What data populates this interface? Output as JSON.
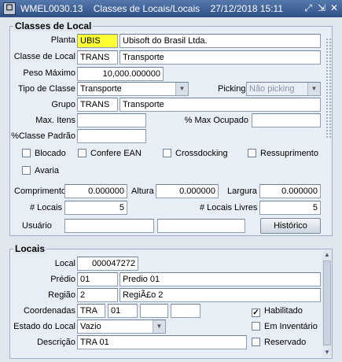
{
  "window": {
    "app_icon": "oracle-forms-icon",
    "title": "WMEL0030.13",
    "subtitle": "Classes de Locais/Locais",
    "datetime": "27/12/2018 15:11"
  },
  "classe": {
    "section_title": "Classes de Local",
    "planta_label": "Planta",
    "planta_code": "UBIS",
    "planta_name": "Ubisoft do Brasil Ltda.",
    "classe_label": "Classe de Local",
    "classe_code": "TRANS",
    "classe_name": "Transporte",
    "peso_label": "Peso Máximo",
    "peso_value": "10,000.000000",
    "tipo_label": "Tipo de Classe",
    "tipo_value": "Transporte",
    "picking_label": "Picking",
    "picking_value": "Não picking",
    "grupo_label": "Grupo",
    "grupo_code": "TRANS",
    "grupo_name": "Transporte",
    "max_itens_label": "Max. Itens",
    "max_itens_value": "",
    "max_ocupado_label": "% Max Ocupado",
    "max_ocupado_value": "",
    "classe_padrao_label": "%Classe Padrão",
    "classe_padrao_value": "",
    "checkboxes": {
      "blocado": {
        "label": "Blocado",
        "checked": false
      },
      "confere_ean": {
        "label": "Confere EAN",
        "checked": false
      },
      "crossdocking": {
        "label": "Crossdocking",
        "checked": false
      },
      "ressuprimento": {
        "label": "Ressuprimento",
        "checked": false
      },
      "avaria": {
        "label": "Avaria",
        "checked": false
      }
    },
    "comprimento_label": "Comprimento",
    "comprimento_value": "0.000000",
    "altura_label": "Altura",
    "altura_value": "0.000000",
    "largura_label": "Largura",
    "largura_value": "0.000000",
    "locais_label": "# Locais",
    "locais_value": "5",
    "locais_livres_label": "# Locais Livres",
    "locais_livres_value": "5",
    "usuario_label": "Usuário",
    "usuario_value": "",
    "usuario_extra": "",
    "historico_button": "Histórico"
  },
  "locais": {
    "section_title": "Locais",
    "local_label": "Local",
    "local_value": "000047272",
    "predio_label": "Prédio",
    "predio_code": "01",
    "predio_name": "Predio 01",
    "regiao_label": "Região",
    "regiao_code": "2",
    "regiao_name": "RegiÃ£o 2",
    "coord_label": "Coordenadas",
    "coord_values": [
      "TRA",
      "01",
      "",
      ""
    ],
    "habilitado": {
      "label": "Habilitado",
      "checked": true
    },
    "estado_label": "Estado do Local",
    "estado_value": "Vazio",
    "em_inventario": {
      "label": "Em Inventário",
      "checked": false
    },
    "descricao_label": "Descrição",
    "descricao_value": "TRA 01",
    "reservado": {
      "label": "Reservado",
      "checked": false
    }
  },
  "colors": {
    "highlight_field": "#ffff33",
    "title_bar": "#2f4f86"
  }
}
